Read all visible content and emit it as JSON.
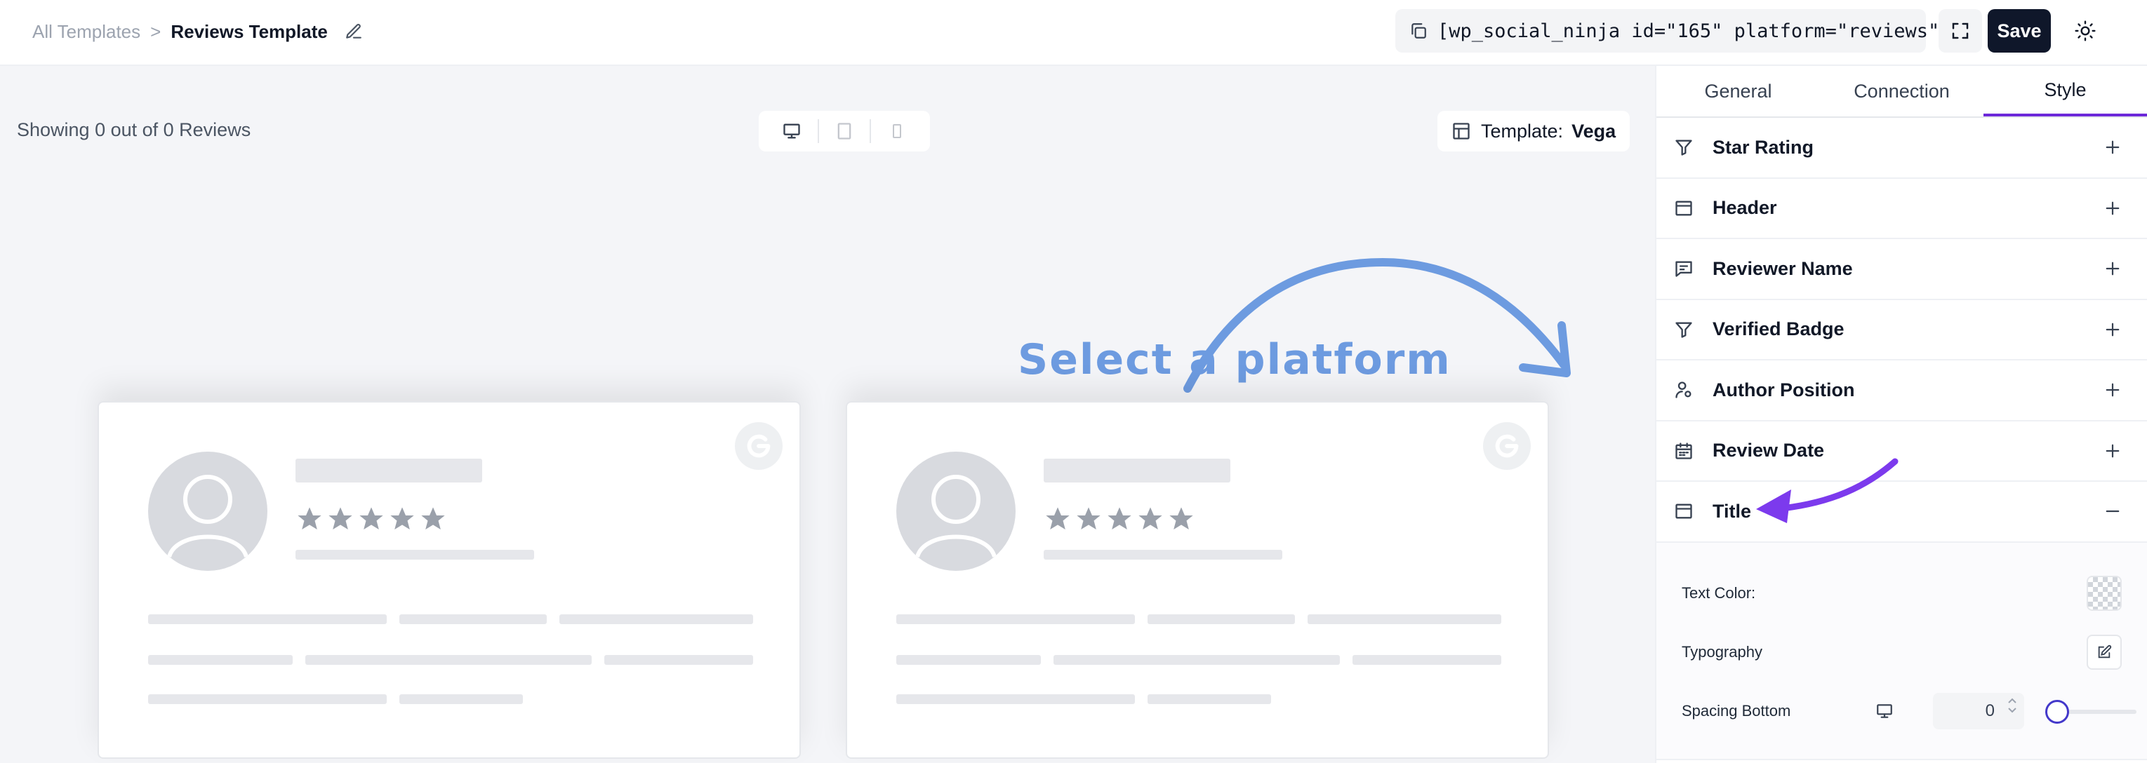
{
  "breadcrumb": {
    "root": "All Templates",
    "separator": ">",
    "current": "Reviews Template"
  },
  "topbar": {
    "shortcode": "[wp_social_ninja id=\"165\" platform=\"reviews\"]",
    "save_label": "Save"
  },
  "canvas": {
    "showing_text": "Showing 0 out of 0 Reviews",
    "template_label": "Template:",
    "template_value": "Vega",
    "annotation": "Select a platform"
  },
  "panel": {
    "tabs": [
      {
        "label": "General",
        "active": false
      },
      {
        "label": "Connection",
        "active": false
      },
      {
        "label": "Style",
        "active": true
      }
    ],
    "sections": [
      {
        "label": "Star Rating",
        "icon": "filter-icon",
        "expanded": false
      },
      {
        "label": "Header",
        "icon": "layout-icon",
        "expanded": false
      },
      {
        "label": "Reviewer Name",
        "icon": "message-square-icon",
        "expanded": false
      },
      {
        "label": "Verified Badge",
        "icon": "filter-icon",
        "expanded": false
      },
      {
        "label": "Author Position",
        "icon": "user-pin-icon",
        "expanded": false
      },
      {
        "label": "Review Date",
        "icon": "calendar-icon",
        "expanded": false
      },
      {
        "label": "Title",
        "icon": "layout-icon",
        "expanded": true
      }
    ],
    "title_settings": {
      "text_color_label": "Text Color:",
      "typography_label": "Typography",
      "spacing_bottom_label": "Spacing Bottom",
      "spacing_bottom_value": "0"
    }
  },
  "colors": {
    "accent": "#6d28d9",
    "annotation": "#6d9be0",
    "save_bg": "#0f172a",
    "canvas_bg": "#f4f5f8"
  }
}
